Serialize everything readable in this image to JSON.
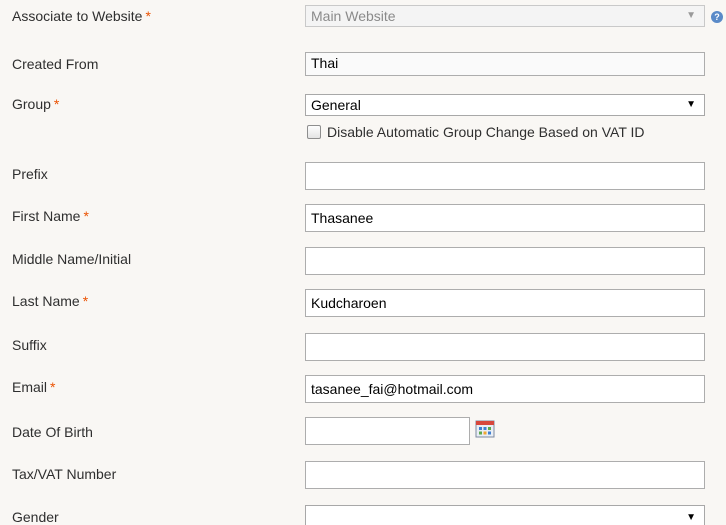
{
  "fields": {
    "website": {
      "label": "Associate to Website",
      "required": "*",
      "value": "Main Website",
      "help": "?"
    },
    "created_from": {
      "label": "Created From",
      "value": "Thai"
    },
    "group": {
      "label": "Group",
      "required": "*",
      "value": "General"
    },
    "vat_checkbox": {
      "label": "Disable Automatic Group Change Based on VAT ID",
      "checked": false
    },
    "prefix": {
      "label": "Prefix",
      "value": ""
    },
    "first_name": {
      "label": "First Name",
      "required": "*",
      "value": "Thasanee"
    },
    "middle_name": {
      "label": "Middle Name/Initial",
      "value": ""
    },
    "last_name": {
      "label": "Last Name",
      "required": "*",
      "value": "Kudcharoen"
    },
    "suffix": {
      "label": "Suffix",
      "value": ""
    },
    "email": {
      "label": "Email",
      "required": "*",
      "value": "tasanee_fai@hotmail.com"
    },
    "dob": {
      "label": "Date Of Birth",
      "value": "",
      "icon": "calendar-icon"
    },
    "taxvat": {
      "label": "Tax/VAT Number",
      "value": ""
    },
    "gender": {
      "label": "Gender",
      "value": ""
    }
  },
  "icons": {
    "dropdown_arrow": "▼"
  }
}
